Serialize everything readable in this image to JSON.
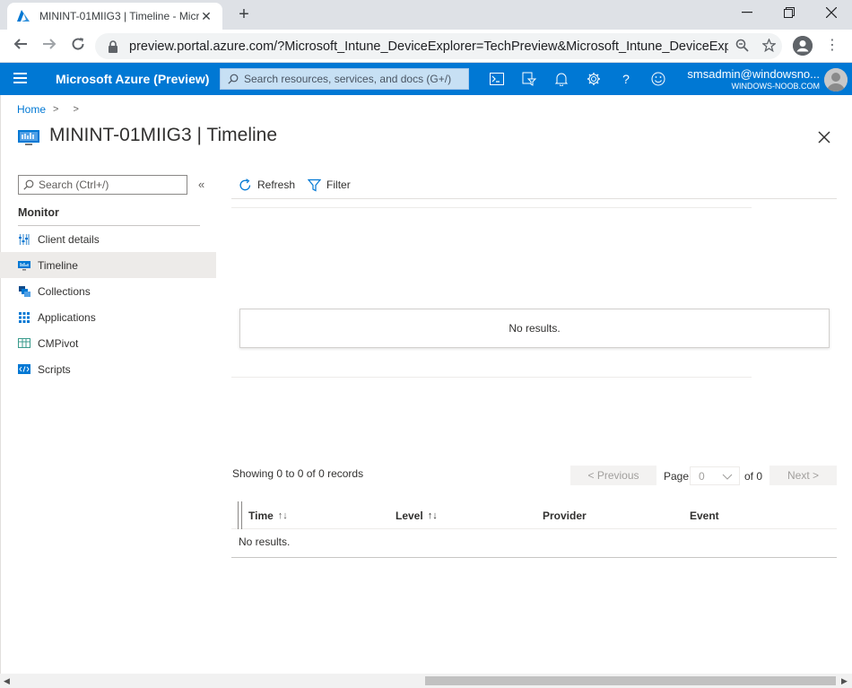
{
  "browser": {
    "tab_title": "MININT-01MIIG3 | Timeline - Microsoft Azure",
    "url": "preview.portal.azure.com/?Microsoft_Intune_DeviceExplorer=TechPreview&Microsoft_Intune_DeviceExplo..."
  },
  "header": {
    "brand": "Microsoft Azure (Preview)",
    "search_placeholder": "Search resources, services, and docs (G+/)",
    "user_name": "smsadmin@windowsno...",
    "user_org": "WINDOWS-NOOB.COM"
  },
  "breadcrumb": {
    "home": "Home"
  },
  "page": {
    "title": "MININT-01MIIG3 | Timeline"
  },
  "sidebar": {
    "search_placeholder": "Search (Ctrl+/)",
    "section": "Monitor",
    "items": [
      {
        "label": "Client details",
        "icon": "client-details-icon"
      },
      {
        "label": "Timeline",
        "icon": "timeline-icon",
        "active": true
      },
      {
        "label": "Collections",
        "icon": "collections-icon"
      },
      {
        "label": "Applications",
        "icon": "applications-icon"
      },
      {
        "label": "CMPivot",
        "icon": "cmpivot-icon"
      },
      {
        "label": "Scripts",
        "icon": "scripts-icon"
      }
    ]
  },
  "commands": {
    "refresh": "Refresh",
    "filter": "Filter"
  },
  "chart_area": {
    "empty_message": "No results."
  },
  "pager": {
    "showing": "Showing 0 to 0 of 0 records",
    "previous": "< Previous",
    "page_label": "Page",
    "page_value": "0",
    "of_label": "of 0",
    "next": "Next >"
  },
  "table": {
    "columns": [
      "Time",
      "Level",
      "Provider",
      "Event"
    ],
    "empty_message": "No results."
  },
  "colors": {
    "azure_blue": "#0078d4",
    "active_nav": "#edebe9"
  }
}
